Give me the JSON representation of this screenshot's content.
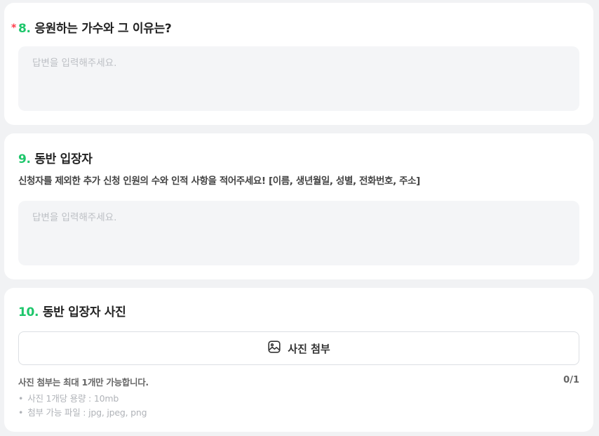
{
  "questions": [
    {
      "number": "8.",
      "required_mark": "*",
      "title": "응원하는 가수와 그 이유는?",
      "answer_placeholder": "답변을 입력해주세요."
    },
    {
      "number": "9.",
      "title": "동반 입장자",
      "description": "신청자를 제외한 추가 신청 인원의 수와 인적 사항을 적어주세요! [이름, 생년월일, 성별, 전화번호, 주소]",
      "answer_placeholder": "답변을 입력해주세요."
    },
    {
      "number": "10.",
      "title": "동반 입장자 사진",
      "attach_button_label": "사진 첨부",
      "attach_note": "사진 첨부는 최대 1개만 가능합니다.",
      "attach_count": "0/1",
      "attach_rules": [
        "사진 1개당 용량 : 10mb",
        "첨부 가능 파일 : jpg, jpeg, png"
      ]
    }
  ],
  "colors": {
    "question_number": "#1ec66b",
    "required_mark": "#ff3b4a",
    "input_background": "#f4f5f7"
  },
  "icons": {
    "attach": "image-icon"
  }
}
